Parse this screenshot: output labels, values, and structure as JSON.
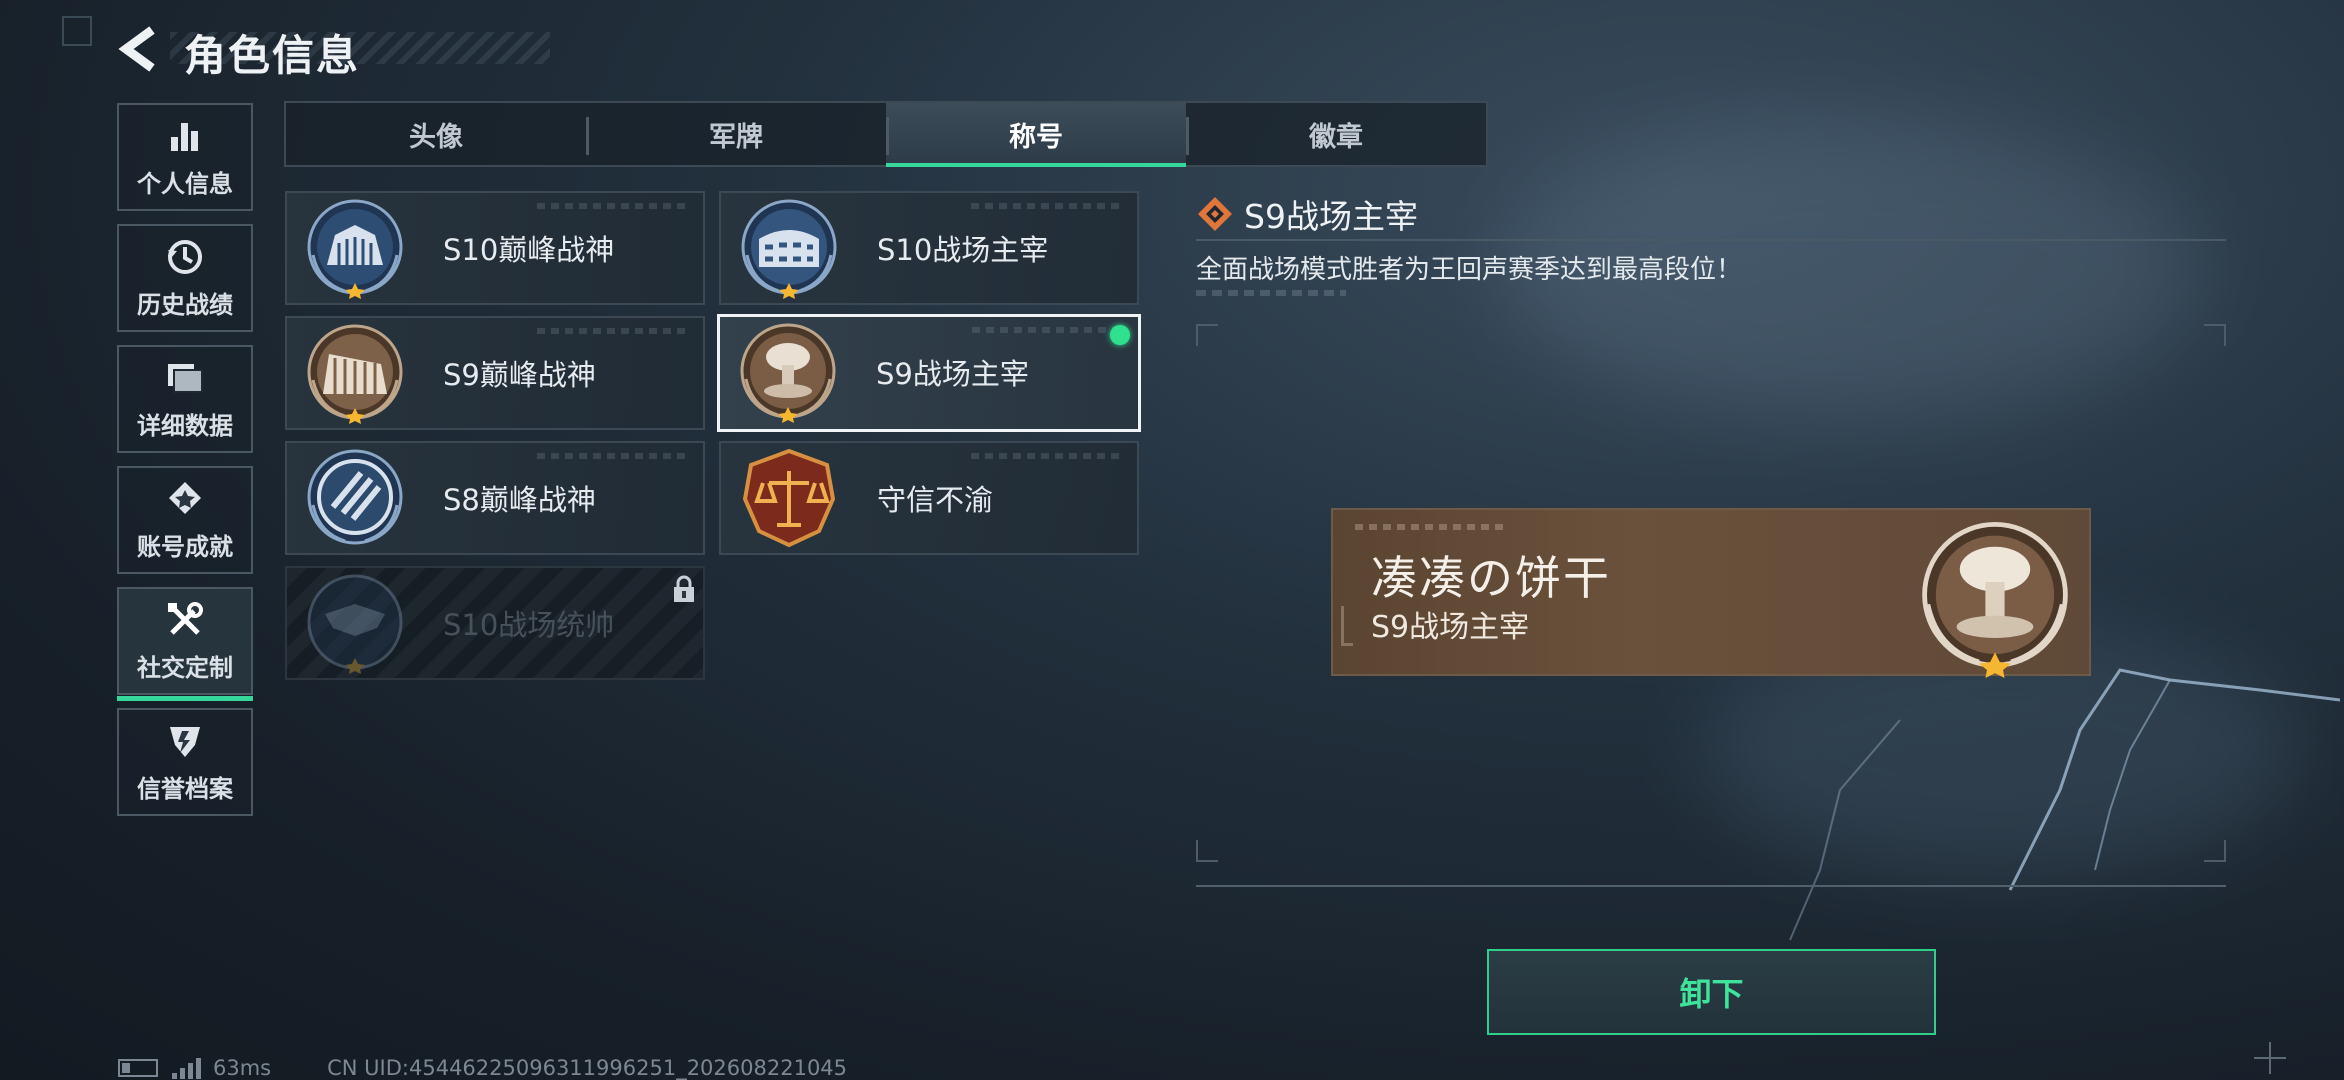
{
  "header": {
    "title": "角色信息"
  },
  "sidebar": {
    "items": [
      {
        "label": "个人信息",
        "icon": "bar-chart-icon",
        "active": false
      },
      {
        "label": "历史战绩",
        "icon": "history-clock-icon",
        "active": false
      },
      {
        "label": "详细数据",
        "icon": "folder-icon",
        "active": false
      },
      {
        "label": "账号成就",
        "icon": "medal-icon",
        "active": false
      },
      {
        "label": "社交定制",
        "icon": "tools-icon",
        "active": true
      },
      {
        "label": "信誉档案",
        "icon": "credit-shield-icon",
        "active": false
      }
    ]
  },
  "tabs": [
    {
      "label": "头像",
      "active": false
    },
    {
      "label": "军牌",
      "active": false
    },
    {
      "label": "称号",
      "active": true
    },
    {
      "label": "徽章",
      "active": false
    }
  ],
  "titles": [
    {
      "name": "S10巅峰战神",
      "emblem": "blue-temple-emblem-icon",
      "state": "normal"
    },
    {
      "name": "S10战场主宰",
      "emblem": "blue-colosseum-emblem-icon",
      "state": "normal"
    },
    {
      "name": "S9巅峰战神",
      "emblem": "bronze-dam-emblem-icon",
      "state": "normal"
    },
    {
      "name": "S9战场主宰",
      "emblem": "mushroom-cloud-emblem-icon",
      "state": "selected",
      "equipped": true
    },
    {
      "name": "S8巅峰战神",
      "emblem": "blue-stripes-emblem-icon",
      "state": "normal"
    },
    {
      "name": "守信不渝",
      "emblem": "scales-emblem-icon",
      "state": "normal"
    },
    {
      "name": "S10战场统帅",
      "emblem": "aircraft-emblem-icon",
      "state": "locked"
    }
  ],
  "detail": {
    "title": "S9战场主宰",
    "description": "全面战场模式胜者为王回声赛季达到最高段位！"
  },
  "preview": {
    "player_name": "凑凑の饼干",
    "title": "S9战场主宰"
  },
  "actions": {
    "unequip_label": "卸下"
  },
  "status_bar": {
    "ping": "63ms",
    "uid": "CN UID:4544622509631199625​1_202608221045"
  },
  "colors": {
    "accent": "#35d79a",
    "equipped_dot": "#2fe08f",
    "medal_orange": "#e0763a"
  }
}
